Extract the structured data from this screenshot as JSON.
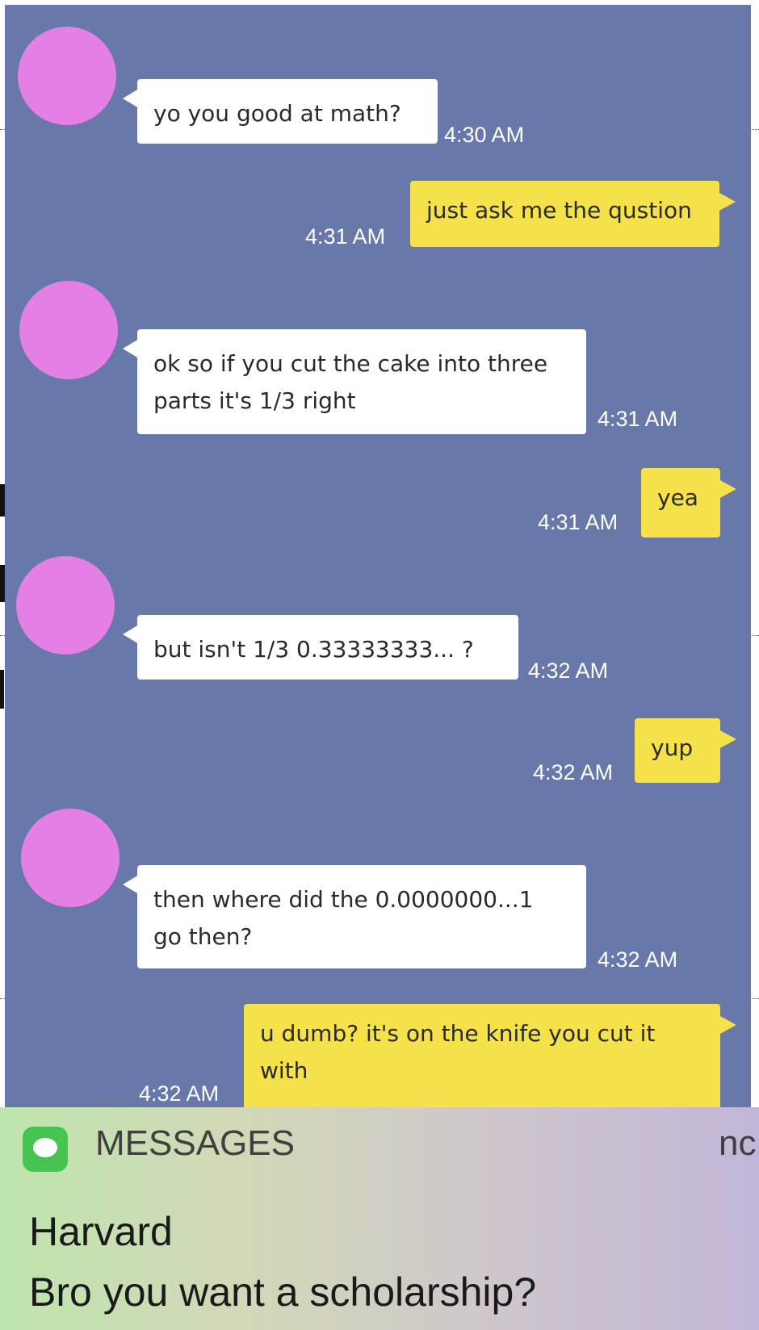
{
  "chat": {
    "background_color": "#6878a9",
    "avatar_color": "#e47fe6",
    "messages": [
      {
        "direction": "in",
        "text": "yo you good at math?",
        "time": "4:30 AM"
      },
      {
        "direction": "out",
        "text": "just ask me the qustion",
        "time": "4:31 AM"
      },
      {
        "direction": "in",
        "text": "ok so if you cut the cake into three\n parts it's 1/3 right",
        "time": "4:31 AM"
      },
      {
        "direction": "out",
        "text": "yea",
        "time": "4:31 AM"
      },
      {
        "direction": "in",
        "text": "but isn't 1/3 0.33333333... ?",
        "time": "4:32 AM"
      },
      {
        "direction": "out",
        "text": "yup",
        "time": "4:32 AM"
      },
      {
        "direction": "in",
        "text": "then where did the 0.0000000...1\ngo then?",
        "time": "4:32 AM"
      },
      {
        "direction": "out",
        "text": "u dumb? it's on the knife you cut it\nwith",
        "time": "4:32 AM"
      }
    ]
  },
  "notification": {
    "app_name": "MESSAGES",
    "time": "nc",
    "sender": "Harvard",
    "body": "Bro you want a scholarship?"
  }
}
